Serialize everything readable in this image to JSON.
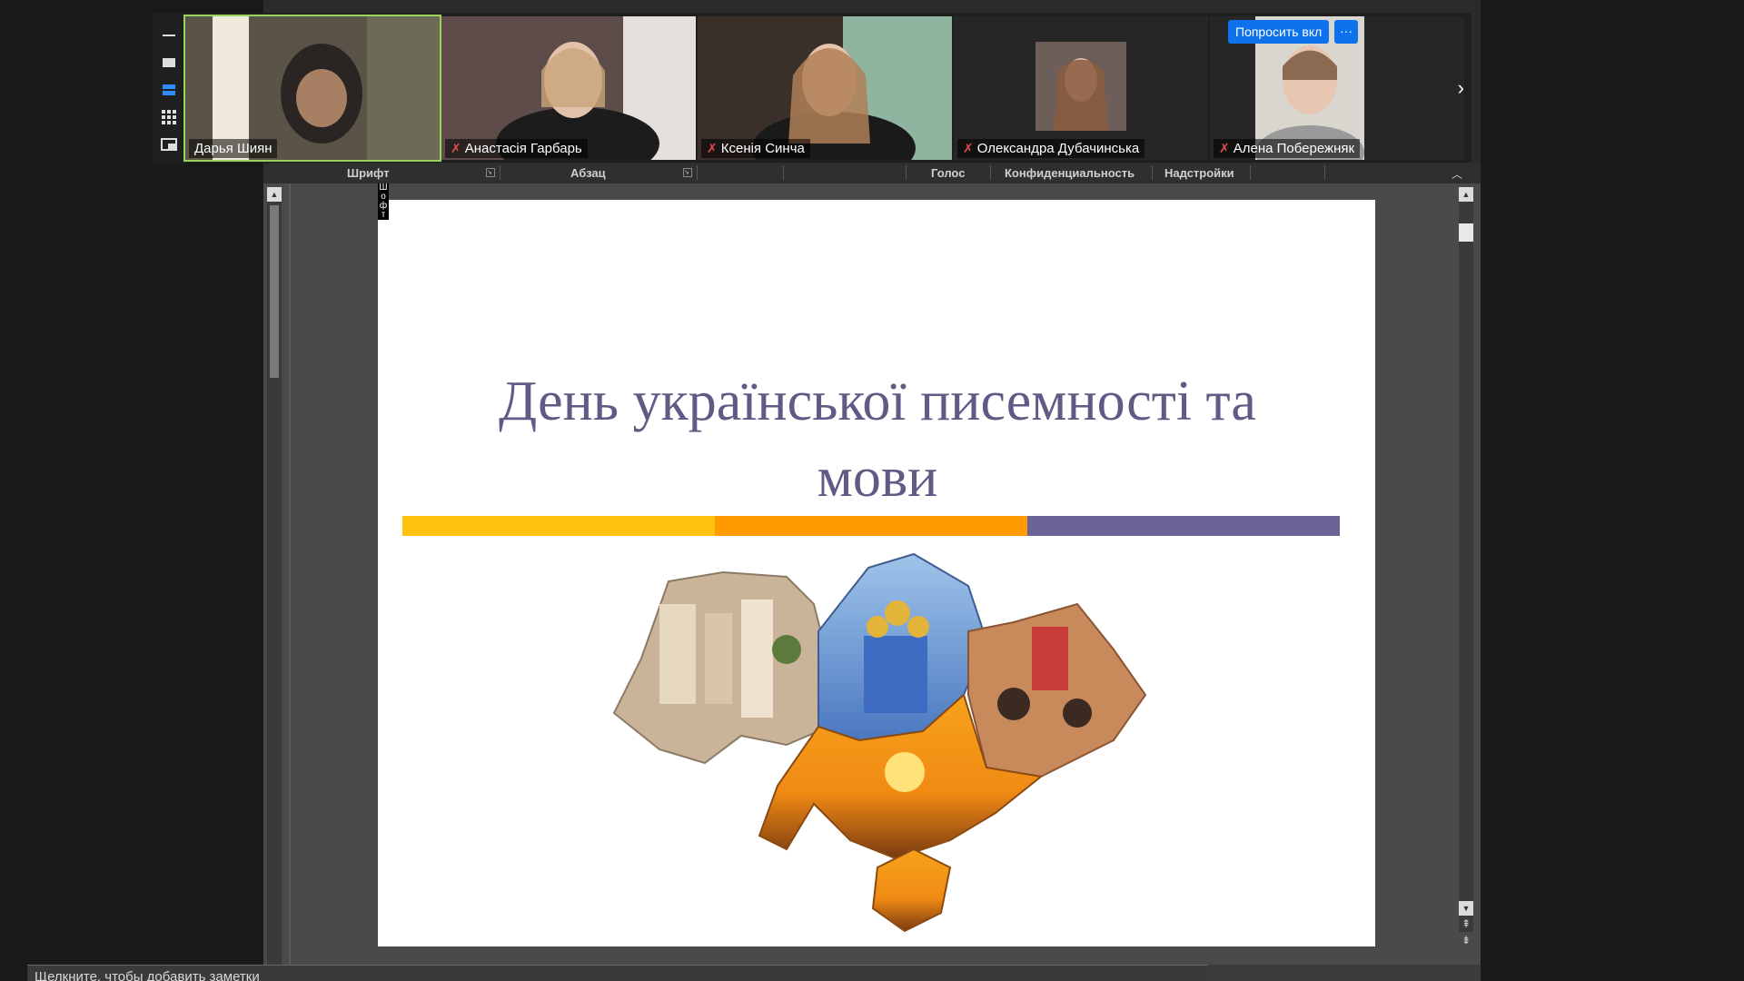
{
  "zoom": {
    "participants": [
      {
        "name": "Дарья Шиян",
        "muted": false,
        "active": true
      },
      {
        "name": "Анастасія Гарбарь",
        "muted": true,
        "active": false
      },
      {
        "name": "Ксенія Синча",
        "muted": true,
        "active": false
      },
      {
        "name": "Олександра Дубачинська",
        "muted": true,
        "active": false
      },
      {
        "name": "Алена Побережняк",
        "muted": true,
        "active": false
      }
    ],
    "ask_button_label": "Попросить вкл",
    "more_button_label": "···",
    "next_label": "›",
    "side_tools": [
      "minimize-icon",
      "single-view-icon",
      "strip-view-icon",
      "grid-view-icon",
      "share-view-icon"
    ]
  },
  "ribbon": {
    "groups": [
      "Шрифт",
      "Абзац",
      "Голос",
      "Конфиденциальность",
      "Надстройки"
    ]
  },
  "slide": {
    "title": "День української писемності та мови",
    "stripe_colors": [
      "#ffc20e",
      "#ff9a00",
      "#6b6396"
    ],
    "map_alt": "Ukraine map collage"
  },
  "side_label": "Ш о ф т",
  "notes_placeholder": "Щелкните, чтобы добавить заметки"
}
